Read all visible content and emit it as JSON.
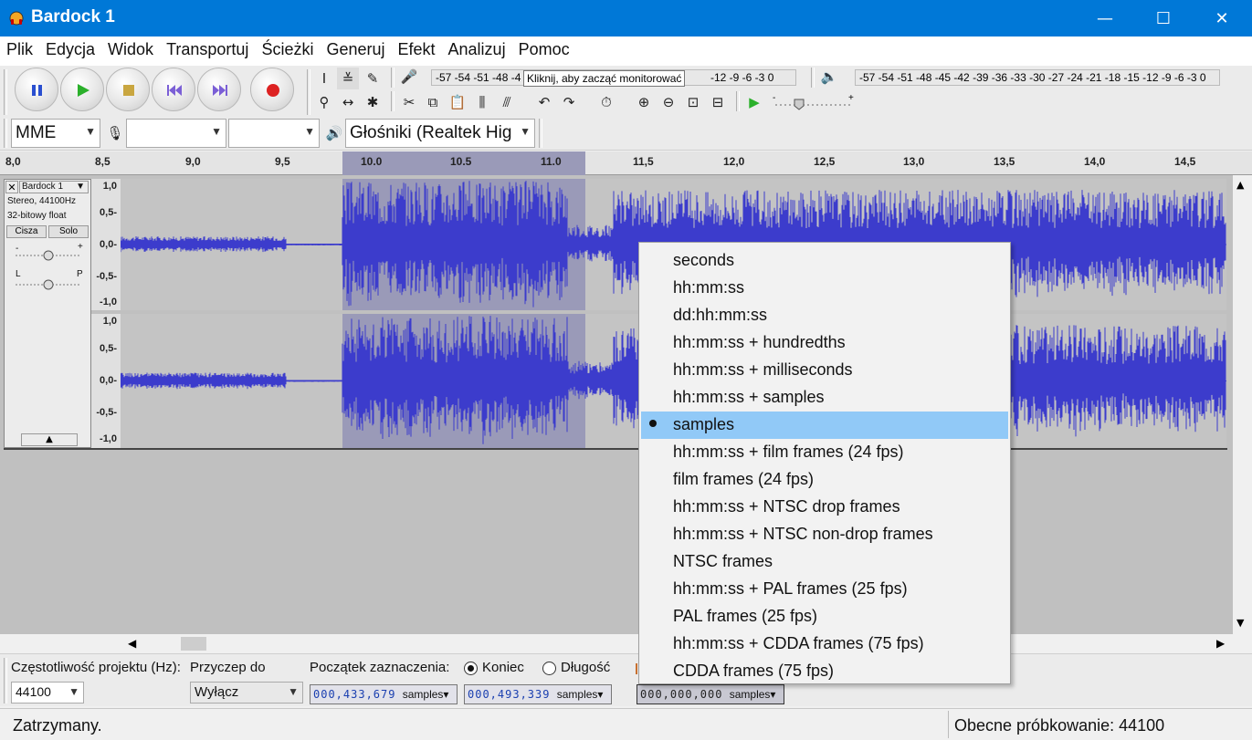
{
  "window": {
    "title": "Bardock 1",
    "minimize": "—",
    "maximize": "☐",
    "close": "✕"
  },
  "menu": [
    "Plik",
    "Edycja",
    "Widok",
    "Transportuj",
    "Ścieżki",
    "Generuj",
    "Efekt",
    "Analizuj",
    "Pomoc"
  ],
  "meters": {
    "record_scale": "-57 -54 -51 -48 -4",
    "record_tooltip": "Kliknij, aby zacząć monitorować",
    "record_scale_tail": "-12 -9 -6 -3 0",
    "play_scale": "-57 -54 -51 -48 -45 -42 -39 -36 -33 -30 -27 -24 -21 -18 -15 -12 -9 -6 -3 0"
  },
  "device": {
    "host": "MME",
    "input_device": "",
    "channels": "",
    "output_device": "Głośniki (Realtek Hig"
  },
  "ruler": {
    "ticks": [
      "8,0",
      "8,5",
      "9,0",
      "9,5",
      "10.0",
      "10.5",
      "11.0",
      "11,5",
      "12,0",
      "12,5",
      "13,0",
      "13,5",
      "14,0",
      "14,5"
    ]
  },
  "track": {
    "name": "Bardock 1",
    "info1": "Stereo, 44100Hz",
    "info2": "32-bitowy float",
    "mute": "Cisza",
    "solo": "Solo",
    "gain_minus": "-",
    "gain_plus": "+",
    "pan_left": "L",
    "pan_right": "P",
    "scale": [
      "1,0",
      "0,5-",
      "0,0-",
      "-0,5-",
      "-1,0"
    ]
  },
  "selection_toolbar": {
    "rate_label": "Częstotliwość projektu (Hz):",
    "rate_value": "44100",
    "snap_label": "Przyczep do",
    "snap_value": "Wyłącz",
    "start_label": "Początek zaznaczenia:",
    "end_radio": "Koniec",
    "length_radio": "Długość",
    "start_digits": "000,433,679",
    "end_digits": "000,493,339",
    "pos_digits": "000,000,000",
    "unit": "samples"
  },
  "status": {
    "left": "Zatrzymany.",
    "right": "Obecne próbkowanie: 44100"
  },
  "format_menu": {
    "selected_index": 6,
    "items": [
      "seconds",
      "hh:mm:ss",
      "dd:hh:mm:ss",
      "hh:mm:ss + hundredths",
      "hh:mm:ss + milliseconds",
      "hh:mm:ss + samples",
      "samples",
      "hh:mm:ss + film frames (24 fps)",
      "film frames (24 fps)",
      "hh:mm:ss + NTSC drop frames",
      "hh:mm:ss + NTSC non-drop frames",
      "NTSC frames",
      "hh:mm:ss + PAL frames (25 fps)",
      "PAL frames (25 fps)",
      "hh:mm:ss + CDDA frames (75 fps)",
      "CDDA frames (75 fps)"
    ]
  },
  "colors": {
    "titlebar": "#0078d7",
    "waveform": "#3c3ccc",
    "selection": "#9a9ab8",
    "menu_highlight": "#91c9f7"
  }
}
